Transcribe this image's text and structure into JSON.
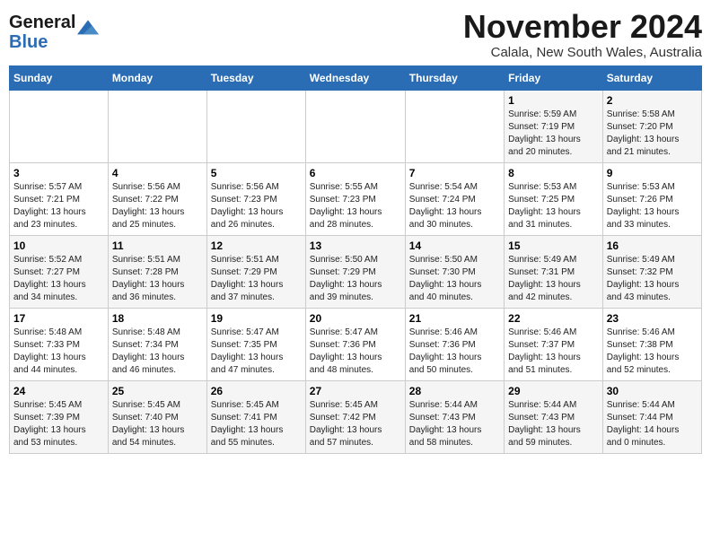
{
  "logo": {
    "line1": "General",
    "line2": "Blue"
  },
  "title": "November 2024",
  "subtitle": "Calala, New South Wales, Australia",
  "days_of_week": [
    "Sunday",
    "Monday",
    "Tuesday",
    "Wednesday",
    "Thursday",
    "Friday",
    "Saturday"
  ],
  "weeks": [
    [
      {
        "day": "",
        "info": ""
      },
      {
        "day": "",
        "info": ""
      },
      {
        "day": "",
        "info": ""
      },
      {
        "day": "",
        "info": ""
      },
      {
        "day": "",
        "info": ""
      },
      {
        "day": "1",
        "info": "Sunrise: 5:59 AM\nSunset: 7:19 PM\nDaylight: 13 hours\nand 20 minutes."
      },
      {
        "day": "2",
        "info": "Sunrise: 5:58 AM\nSunset: 7:20 PM\nDaylight: 13 hours\nand 21 minutes."
      }
    ],
    [
      {
        "day": "3",
        "info": "Sunrise: 5:57 AM\nSunset: 7:21 PM\nDaylight: 13 hours\nand 23 minutes."
      },
      {
        "day": "4",
        "info": "Sunrise: 5:56 AM\nSunset: 7:22 PM\nDaylight: 13 hours\nand 25 minutes."
      },
      {
        "day": "5",
        "info": "Sunrise: 5:56 AM\nSunset: 7:23 PM\nDaylight: 13 hours\nand 26 minutes."
      },
      {
        "day": "6",
        "info": "Sunrise: 5:55 AM\nSunset: 7:23 PM\nDaylight: 13 hours\nand 28 minutes."
      },
      {
        "day": "7",
        "info": "Sunrise: 5:54 AM\nSunset: 7:24 PM\nDaylight: 13 hours\nand 30 minutes."
      },
      {
        "day": "8",
        "info": "Sunrise: 5:53 AM\nSunset: 7:25 PM\nDaylight: 13 hours\nand 31 minutes."
      },
      {
        "day": "9",
        "info": "Sunrise: 5:53 AM\nSunset: 7:26 PM\nDaylight: 13 hours\nand 33 minutes."
      }
    ],
    [
      {
        "day": "10",
        "info": "Sunrise: 5:52 AM\nSunset: 7:27 PM\nDaylight: 13 hours\nand 34 minutes."
      },
      {
        "day": "11",
        "info": "Sunrise: 5:51 AM\nSunset: 7:28 PM\nDaylight: 13 hours\nand 36 minutes."
      },
      {
        "day": "12",
        "info": "Sunrise: 5:51 AM\nSunset: 7:29 PM\nDaylight: 13 hours\nand 37 minutes."
      },
      {
        "day": "13",
        "info": "Sunrise: 5:50 AM\nSunset: 7:29 PM\nDaylight: 13 hours\nand 39 minutes."
      },
      {
        "day": "14",
        "info": "Sunrise: 5:50 AM\nSunset: 7:30 PM\nDaylight: 13 hours\nand 40 minutes."
      },
      {
        "day": "15",
        "info": "Sunrise: 5:49 AM\nSunset: 7:31 PM\nDaylight: 13 hours\nand 42 minutes."
      },
      {
        "day": "16",
        "info": "Sunrise: 5:49 AM\nSunset: 7:32 PM\nDaylight: 13 hours\nand 43 minutes."
      }
    ],
    [
      {
        "day": "17",
        "info": "Sunrise: 5:48 AM\nSunset: 7:33 PM\nDaylight: 13 hours\nand 44 minutes."
      },
      {
        "day": "18",
        "info": "Sunrise: 5:48 AM\nSunset: 7:34 PM\nDaylight: 13 hours\nand 46 minutes."
      },
      {
        "day": "19",
        "info": "Sunrise: 5:47 AM\nSunset: 7:35 PM\nDaylight: 13 hours\nand 47 minutes."
      },
      {
        "day": "20",
        "info": "Sunrise: 5:47 AM\nSunset: 7:36 PM\nDaylight: 13 hours\nand 48 minutes."
      },
      {
        "day": "21",
        "info": "Sunrise: 5:46 AM\nSunset: 7:36 PM\nDaylight: 13 hours\nand 50 minutes."
      },
      {
        "day": "22",
        "info": "Sunrise: 5:46 AM\nSunset: 7:37 PM\nDaylight: 13 hours\nand 51 minutes."
      },
      {
        "day": "23",
        "info": "Sunrise: 5:46 AM\nSunset: 7:38 PM\nDaylight: 13 hours\nand 52 minutes."
      }
    ],
    [
      {
        "day": "24",
        "info": "Sunrise: 5:45 AM\nSunset: 7:39 PM\nDaylight: 13 hours\nand 53 minutes."
      },
      {
        "day": "25",
        "info": "Sunrise: 5:45 AM\nSunset: 7:40 PM\nDaylight: 13 hours\nand 54 minutes."
      },
      {
        "day": "26",
        "info": "Sunrise: 5:45 AM\nSunset: 7:41 PM\nDaylight: 13 hours\nand 55 minutes."
      },
      {
        "day": "27",
        "info": "Sunrise: 5:45 AM\nSunset: 7:42 PM\nDaylight: 13 hours\nand 57 minutes."
      },
      {
        "day": "28",
        "info": "Sunrise: 5:44 AM\nSunset: 7:43 PM\nDaylight: 13 hours\nand 58 minutes."
      },
      {
        "day": "29",
        "info": "Sunrise: 5:44 AM\nSunset: 7:43 PM\nDaylight: 13 hours\nand 59 minutes."
      },
      {
        "day": "30",
        "info": "Sunrise: 5:44 AM\nSunset: 7:44 PM\nDaylight: 14 hours\nand 0 minutes."
      }
    ]
  ]
}
